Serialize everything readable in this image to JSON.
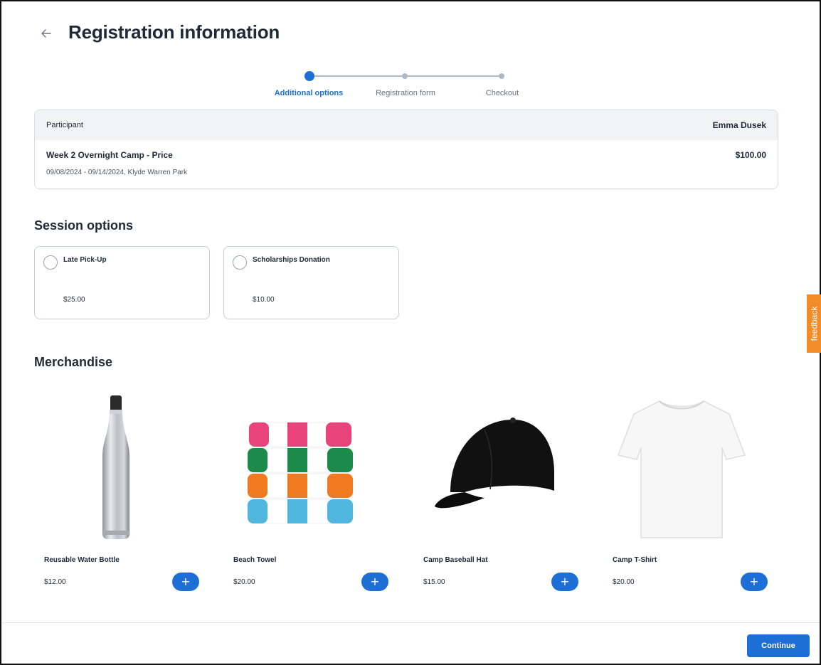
{
  "header": {
    "title": "Registration information",
    "back_icon": "arrow-left-icon"
  },
  "stepper": {
    "steps": [
      {
        "label": "Additional options",
        "active": true
      },
      {
        "label": "Registration form",
        "active": false
      },
      {
        "label": "Checkout",
        "active": false
      }
    ]
  },
  "participant": {
    "header_label": "Participant",
    "name": "Emma Dusek",
    "item_title": "Week 2 Overnight Camp - Price",
    "item_price": "$100.00",
    "item_details": "09/08/2024 - 09/14/2024, Klyde Warren Park"
  },
  "session_options": {
    "title": "Session options",
    "options": [
      {
        "label": "Late Pick-Up",
        "price": "$25.00",
        "selected": false
      },
      {
        "label": "Scholarships Donation",
        "price": "$10.00",
        "selected": false
      }
    ]
  },
  "merchandise": {
    "title": "Merchandise",
    "items": [
      {
        "name": "Reusable Water Bottle",
        "price": "$12.00",
        "image": "water-bottle"
      },
      {
        "name": "Beach Towel",
        "price": "$20.00",
        "image": "beach-towel"
      },
      {
        "name": "Camp Baseball Hat",
        "price": "$15.00",
        "image": "baseball-hat"
      },
      {
        "name": "Camp T-Shirt",
        "price": "$20.00",
        "image": "t-shirt"
      }
    ],
    "add_label": "+"
  },
  "footer": {
    "continue_label": "Continue"
  },
  "feedback": {
    "label": "feedback"
  },
  "colors": {
    "primary": "#1d6fd6",
    "feedback": "#f28c28",
    "step_inactive": "#aebbc7"
  }
}
